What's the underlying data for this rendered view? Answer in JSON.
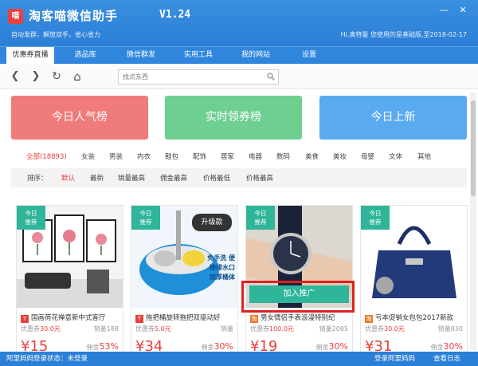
{
  "app": {
    "logo_char": "喵",
    "title": "淘客喵微信助手",
    "version": "V1.24",
    "slogan": "自动发群，解放双手，省心省力",
    "user_info": "Hi,奥特曼 您使用的是基础版,至2018-02-17",
    "window_controls": {
      "minimize": "—",
      "close": "✕"
    }
  },
  "tabs": [
    {
      "label": "优惠券直播",
      "active": true
    },
    {
      "label": "选品库",
      "active": false
    },
    {
      "label": "微信群发",
      "active": false
    },
    {
      "label": "实用工具",
      "active": false
    },
    {
      "label": "我的网站",
      "active": false
    },
    {
      "label": "设置",
      "active": false
    }
  ],
  "nav": {
    "back": "❮",
    "forward": "❯",
    "refresh": "↻",
    "home": "⌂",
    "search_placeholder": "找点东西"
  },
  "banners": [
    {
      "label": "今日人气榜",
      "color": "#ef7b7b"
    },
    {
      "label": "实时领券榜",
      "color": "#6fcf91"
    },
    {
      "label": "今日上新",
      "color": "#5aaaf0"
    }
  ],
  "categories": [
    "全部(18893)",
    "女装",
    "男装",
    "内衣",
    "鞋包",
    "配饰",
    "居家",
    "电器",
    "数码",
    "美食",
    "美妆",
    "母婴",
    "文体",
    "其他"
  ],
  "sort": {
    "label": "排序：",
    "options": [
      "默认",
      "最新",
      "销量最高",
      "佣金最高",
      "价格最低",
      "价格最高"
    ]
  },
  "products": [
    {
      "badge_line1": "今日",
      "badge_line2": "推荐",
      "shop": "T",
      "shop_color": "#e8413d",
      "title": "国画荷花禅意新中式客厅",
      "coupon_label": "优惠券",
      "coupon": "30.0元",
      "sales_label": "销量",
      "sales": "188",
      "price": "¥15",
      "comm_label": "佣金",
      "comm": "53%"
    },
    {
      "badge_line1": "今日",
      "badge_line2": "推荐",
      "shop": "T",
      "shop_color": "#e8413d",
      "title": "拖把桶旋转拖把双驱动好",
      "coupon_label": "优惠券",
      "coupon": "5.0元",
      "sales_label": "销量",
      "sales": "",
      "price": "¥34",
      "comm_label": "佣金",
      "comm": "30%",
      "tag": "升级款",
      "product_text": "免手洗 便捷排水口 加厚桶体"
    },
    {
      "badge_line1": "今日",
      "badge_line2": "推荐",
      "shop": "淘",
      "shop_color": "#f07a2a",
      "title": "男女情侣手表浪漫特别纪",
      "coupon_label": "优惠券",
      "coupon": "100.0元",
      "sales_label": "销量",
      "sales": "2085",
      "price": "¥19",
      "comm_label": "佣金",
      "comm": "30%",
      "button": "加入推广"
    },
    {
      "badge_line1": "今日",
      "badge_line2": "推荐",
      "shop": "淘",
      "shop_color": "#f07a2a",
      "title": "亏本促销女包包2017新款",
      "coupon_label": "优惠券",
      "coupon": "30.0元",
      "sales_label": "销量",
      "sales": "830",
      "price": "¥31",
      "comm_label": "佣金",
      "comm": "30%"
    }
  ],
  "status": {
    "left": "阿里妈妈登录状态：未登录",
    "login": "登录阿里妈妈",
    "log": "查看日志"
  }
}
